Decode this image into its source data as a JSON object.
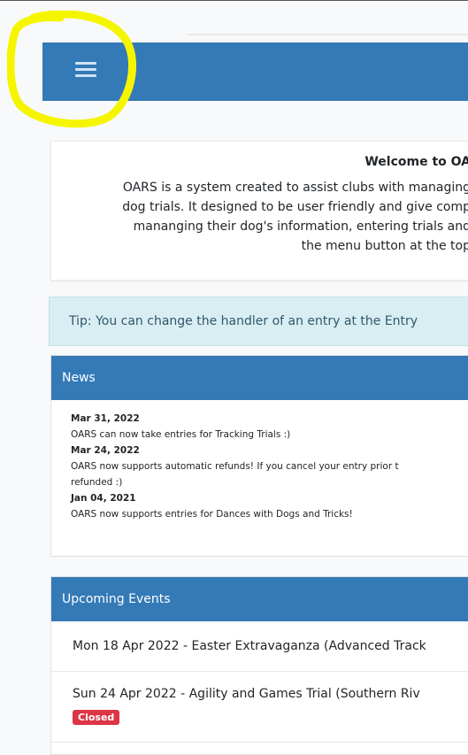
{
  "welcome": {
    "title": "Welcome to OA",
    "lines": [
      "OARS is a system created to assist clubs with managing",
      "dog trials. It designed to be user friendly and give comp",
      "mananging their dog's information, entering trials and",
      "the menu button at the top"
    ]
  },
  "tip": {
    "text": "Tip: You can change the handler of an entry at the Entry"
  },
  "news": {
    "title": "News",
    "items": [
      {
        "date": "Mar 31, 2022",
        "text": "OARS can now take entries for Tracking Trials :)"
      },
      {
        "date": "Mar 24, 2022",
        "text": "OARS now supports automatic refunds! If you cancel your entry prior t",
        "text2": "refunded :)"
      },
      {
        "date": "Jan 04, 2021",
        "text": "OARS now supports entries for Dances with Dogs and Tricks!"
      }
    ]
  },
  "events": {
    "title": "Upcoming Events",
    "items": [
      {
        "label": "Mon 18 Apr 2022 - Easter Extravaganza (Advanced Track"
      },
      {
        "label": "Sun 24 Apr 2022 - Agility and Games Trial (Southern Riv",
        "badge": "Closed"
      }
    ]
  },
  "colors": {
    "navbar": "#337ab7",
    "tip_bg": "#d9eef3",
    "badge": "#dc3545",
    "highlight": "#f5f500"
  },
  "icons": {
    "menu": "hamburger-menu-icon"
  }
}
